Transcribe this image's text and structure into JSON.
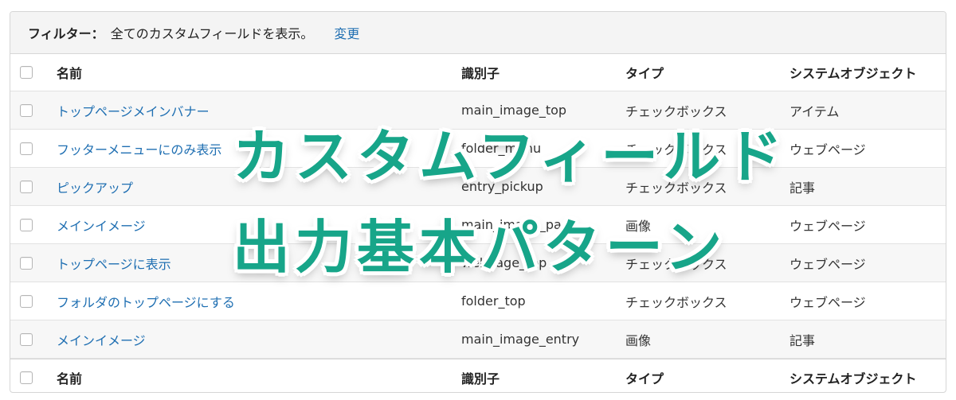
{
  "filter": {
    "label": "フィルター：",
    "text": "全てのカスタムフィールドを表示。",
    "change_link": "変更"
  },
  "columns": {
    "name": "名前",
    "identifier": "識別子",
    "type": "タイプ",
    "system_object": "システムオブジェクト"
  },
  "rows": [
    {
      "name": "トップページメインバナー",
      "identifier": "main_image_top",
      "type": "チェックボックス",
      "system_object": "アイテム"
    },
    {
      "name": "フッターメニューにのみ表示",
      "identifier": "folder_menu",
      "type": "チェックボックス",
      "system_object": "ウェブページ"
    },
    {
      "name": "ピックアップ",
      "identifier": "entry_pickup",
      "type": "チェックボックス",
      "system_object": "記事"
    },
    {
      "name": "メインイメージ",
      "identifier": "main_image_page",
      "type": "画像",
      "system_object": "ウェブページ"
    },
    {
      "name": "トップページに表示",
      "identifier": "webpage_top",
      "type": "チェックボックス",
      "system_object": "ウェブページ"
    },
    {
      "name": "フォルダのトップページにする",
      "identifier": "folder_top",
      "type": "チェックボックス",
      "system_object": "ウェブページ"
    },
    {
      "name": "メインイメージ",
      "identifier": "main_image_entry",
      "type": "画像",
      "system_object": "記事"
    }
  ],
  "overlay": {
    "line1": "カスタムフィールド",
    "line2": "出力基本パターン",
    "color": "#17a589"
  },
  "colors": {
    "link": "#1f6fb2",
    "filter_bg": "#f4f4f4",
    "stripe_bg": "#f7f7f7"
  }
}
